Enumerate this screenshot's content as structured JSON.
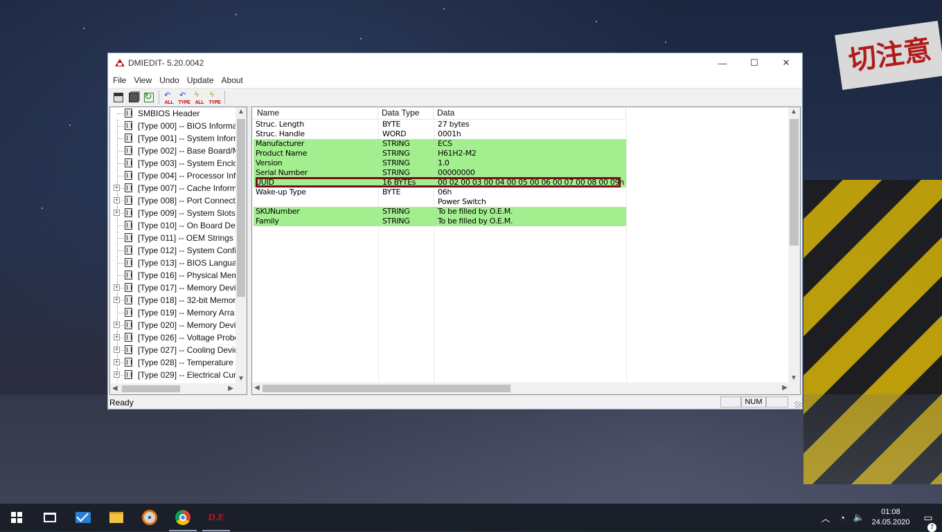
{
  "window": {
    "title": "DMIEDIT- 5.20.0042",
    "controls": {
      "minimize": "—",
      "maximize": "☐",
      "close": "✕"
    }
  },
  "menu": [
    "File",
    "View",
    "Undo",
    "Update",
    "About"
  ],
  "toolbar": {
    "undo_all_label": "ALL",
    "undo_type_label": "TYPE",
    "update_all_label": "ALL",
    "update_type_label": "TYPE"
  },
  "tree": {
    "items": [
      {
        "label": "SMBIOS Header",
        "expandable": false
      },
      {
        "label": "[Type 000] -- BIOS Informa",
        "expandable": false
      },
      {
        "label": "[Type 001] -- System Inforr",
        "expandable": false
      },
      {
        "label": "[Type 002] -- Base Board/M",
        "expandable": false
      },
      {
        "label": "[Type 003] -- System Enclo",
        "expandable": false
      },
      {
        "label": "[Type 004] -- Processor Info",
        "expandable": false
      },
      {
        "label": "[Type 007] -- Cache Inform",
        "expandable": true
      },
      {
        "label": "[Type 008] -- Port Connect",
        "expandable": true
      },
      {
        "label": "[Type 009] -- System Slots",
        "expandable": true
      },
      {
        "label": "[Type 010] -- On Board Dev",
        "expandable": false
      },
      {
        "label": "[Type 011] -- OEM Strings",
        "expandable": false
      },
      {
        "label": "[Type 012] -- System Confi",
        "expandable": false
      },
      {
        "label": "[Type 013] -- BIOS Languag",
        "expandable": false
      },
      {
        "label": "[Type 016] -- Physical Mem",
        "expandable": false
      },
      {
        "label": "[Type 017] -- Memory Devi",
        "expandable": true
      },
      {
        "label": "[Type 018] -- 32-bit Memor",
        "expandable": true
      },
      {
        "label": "[Type 019] -- Memory Arra",
        "expandable": false
      },
      {
        "label": "[Type 020] -- Memory Devi",
        "expandable": true
      },
      {
        "label": "[Type 026] -- Voltage Probe",
        "expandable": true
      },
      {
        "label": "[Type 027] -- Cooling Devic",
        "expandable": true
      },
      {
        "label": "[Type 028] -- Temperature",
        "expandable": true
      },
      {
        "label": "[Type 029] -- Electrical Curr",
        "expandable": true
      }
    ]
  },
  "list": {
    "columns": [
      "Name",
      "Data Type",
      "Data"
    ],
    "rows": [
      {
        "name": "Struc. Length",
        "type": "BYTE",
        "data": "27 bytes",
        "editable": false
      },
      {
        "name": "Struc. Handle",
        "type": "WORD",
        "data": "0001h",
        "editable": false
      },
      {
        "name": "Manufacturer",
        "type": "STRING",
        "data": "ECS",
        "editable": true
      },
      {
        "name": "Product Name",
        "type": "STRING",
        "data": "H61H2-M2",
        "editable": true
      },
      {
        "name": "Version",
        "type": "STRING",
        "data": "1.0",
        "editable": true
      },
      {
        "name": "Serial Number",
        "type": "STRING",
        "data": "00000000",
        "editable": true
      },
      {
        "name": "UUID",
        "type": "16 BYTEs",
        "data": "00 02 00 03 00 04 00 05 00 06 00 07 00 08 00 09h",
        "editable": true
      },
      {
        "name": "Wake-up Type",
        "type": "BYTE",
        "data": "06h",
        "editable": false
      },
      {
        "name": "",
        "type": "",
        "data": "Power Switch",
        "editable": false
      },
      {
        "name": "SKUNumber",
        "type": "STRING",
        "data": "To be filled by O.E.M.",
        "editable": true
      },
      {
        "name": "Family",
        "type": "STRING",
        "data": "To be filled by O.E.M.",
        "editable": true
      }
    ],
    "highlight_color": "#7a0f1b",
    "editable_color": "#a3ef8f"
  },
  "status": {
    "text": "Ready",
    "num": "NUM"
  },
  "taskbar": {
    "clock_time": "01:08",
    "clock_date": "24.05.2020",
    "notification_count": "7",
    "dmi_label": "D.E"
  }
}
